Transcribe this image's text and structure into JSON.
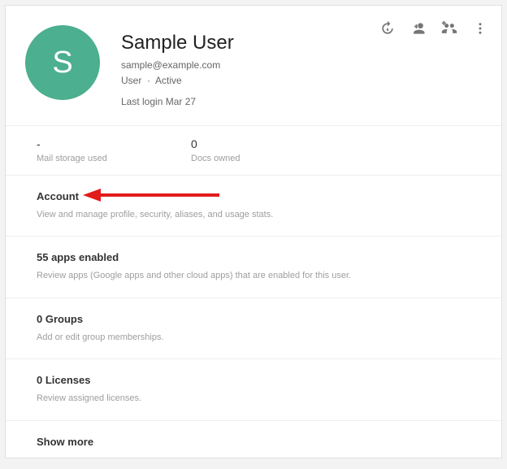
{
  "user": {
    "initial": "S",
    "name": "Sample User",
    "email": "sample@example.com",
    "role": "User",
    "status": "Active",
    "separator": "·",
    "last_login": "Last login Mar 27"
  },
  "stats": {
    "mail_storage_value": "-",
    "mail_storage_label": "Mail storage used",
    "docs_owned_value": "0",
    "docs_owned_label": "Docs owned"
  },
  "sections": {
    "account": {
      "title": "Account",
      "desc": "View and manage profile, security, aliases, and usage stats."
    },
    "apps": {
      "title": "55 apps enabled",
      "desc": "Review apps (Google apps and other cloud apps) that are enabled for this user."
    },
    "groups": {
      "title": "0 Groups",
      "desc": "Add or edit group memberships."
    },
    "licenses": {
      "title": "0 Licenses",
      "desc": "Review assigned licenses."
    }
  },
  "show_more": "Show more"
}
